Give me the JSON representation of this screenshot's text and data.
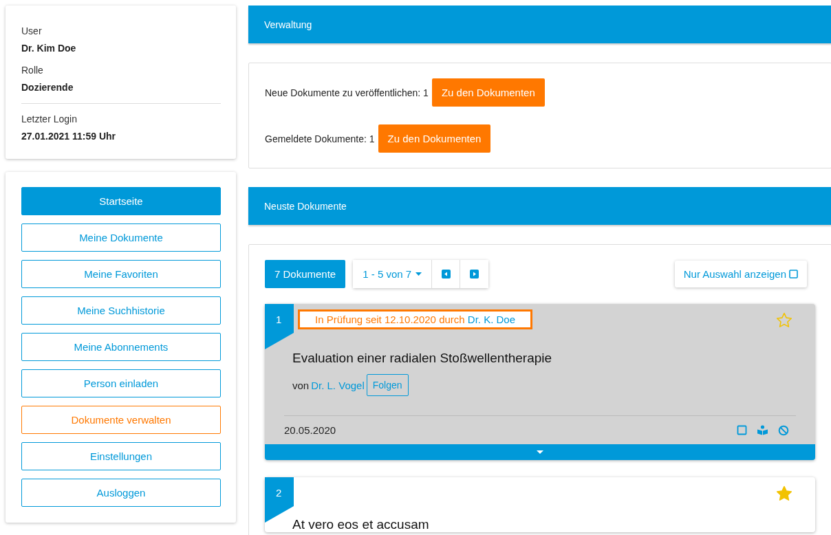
{
  "user_card": {
    "fields": [
      {
        "label": "User",
        "value": "Dr. Kim Doe"
      },
      {
        "label": "Rolle",
        "value": "Dozierende"
      },
      {
        "label": "Letzter Login",
        "value": "27.01.2021 11:59 Uhr"
      }
    ]
  },
  "nav": [
    {
      "label": "Startseite",
      "selected": true,
      "kind": "normal"
    },
    {
      "label": "Meine Dokumente",
      "selected": false,
      "kind": "normal"
    },
    {
      "label": "Meine Favoriten",
      "selected": false,
      "kind": "normal"
    },
    {
      "label": "Meine Suchhistorie",
      "selected": false,
      "kind": "normal"
    },
    {
      "label": "Meine Abonnements",
      "selected": false,
      "kind": "normal"
    },
    {
      "label": "Person einladen",
      "selected": false,
      "kind": "normal"
    },
    {
      "label": "Dokumente verwalten",
      "selected": false,
      "kind": "admin"
    },
    {
      "label": "Einstellungen",
      "selected": false,
      "kind": "normal"
    },
    {
      "label": "Ausloggen",
      "selected": false,
      "kind": "normal"
    }
  ],
  "admin": {
    "title": "Verwaltung",
    "rows": [
      {
        "text": "Neue Dokumente zu veröffentlichen: 1",
        "button": "Zu den Dokumenten"
      },
      {
        "text": "Gemeldete Dokumente: 1",
        "button": "Zu den Dokumenten"
      }
    ]
  },
  "latest": {
    "title": "Neuste Dokumente",
    "count_button": "7 Dokumente",
    "range": "1 - 5 von 7",
    "filter_button": "Nur Auswahl anzeigen",
    "documents": [
      {
        "number": "1",
        "selected": true,
        "starred": false,
        "status": "In Prüfung seit 12.10.2020 durch",
        "reviewer": "Dr. K. Doe",
        "title": "Evaluation einer radialen Stoßwellentherapie",
        "by": "von",
        "author": "Dr. L. Vogel",
        "follow": "Folgen",
        "date": "20.05.2020"
      },
      {
        "number": "2",
        "selected": false,
        "starred": true,
        "title": "At vero eos et accusam"
      }
    ]
  }
}
